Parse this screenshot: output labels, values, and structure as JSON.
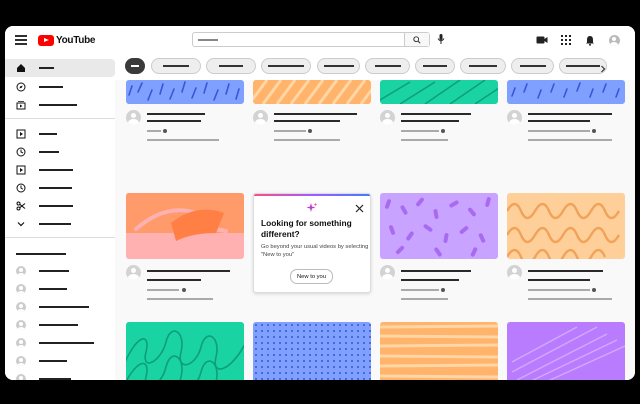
{
  "app": {
    "logo_text": "YouTube"
  },
  "popup": {
    "title": "Looking for something different?",
    "body": "Go beyond your usual videos by selecting \"New to you\"",
    "button_label": "New to you"
  },
  "colors": {
    "brand_red": "#ff0000",
    "thumb_blue": "#7fa0ff",
    "thumb_orange": "#ffb36b",
    "thumb_teal": "#19d3a3",
    "thumb_coral": "#ff9a6a",
    "thumb_pink": "#ffb0b0",
    "thumb_lilac": "#c8a3ff",
    "thumb_peach": "#ffcf99",
    "thumb_purple": "#b97cff"
  }
}
